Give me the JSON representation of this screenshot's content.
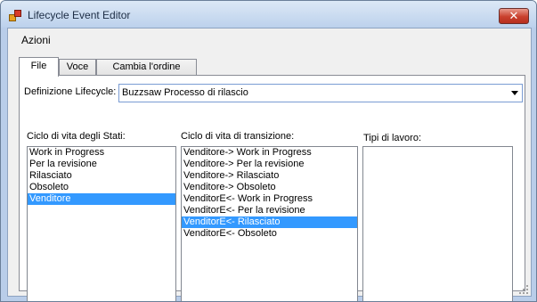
{
  "window": {
    "title": "Lifecycle Event Editor",
    "close_glyph": "✕"
  },
  "menu": {
    "items": [
      "Azioni"
    ]
  },
  "tabs": [
    {
      "label": "File",
      "active": true
    },
    {
      "label": "Voce",
      "active": false
    },
    {
      "label": "Cambia l'ordine",
      "active": false
    }
  ],
  "lifecycle": {
    "label": "Definizione Lifecycle:",
    "selected": "Buzzsaw Processo di rilascio"
  },
  "states": {
    "label": "Ciclo di vita degli Stati:",
    "items": [
      "Work in Progress",
      "Per la revisione",
      "Rilasciato",
      "Obsoleto",
      "Venditore"
    ],
    "selected_index": 4
  },
  "transitions": {
    "label": "Ciclo di vita di transizione:",
    "items": [
      "Venditore-> Work in Progress",
      "Venditore-> Per la revisione",
      "Venditore-> Rilasciato",
      "Venditore-> Obsoleto",
      "VenditorE<- Work in Progress",
      "VenditorE<- Per la revisione",
      "VenditorE<- Rilasciato",
      "VenditorE<- Obsoleto"
    ],
    "selected_index": 6
  },
  "work_types": {
    "label": "Tipi di lavoro:",
    "items": []
  },
  "colors": {
    "selection": "#3399ff",
    "close_button": "#c9402d"
  }
}
